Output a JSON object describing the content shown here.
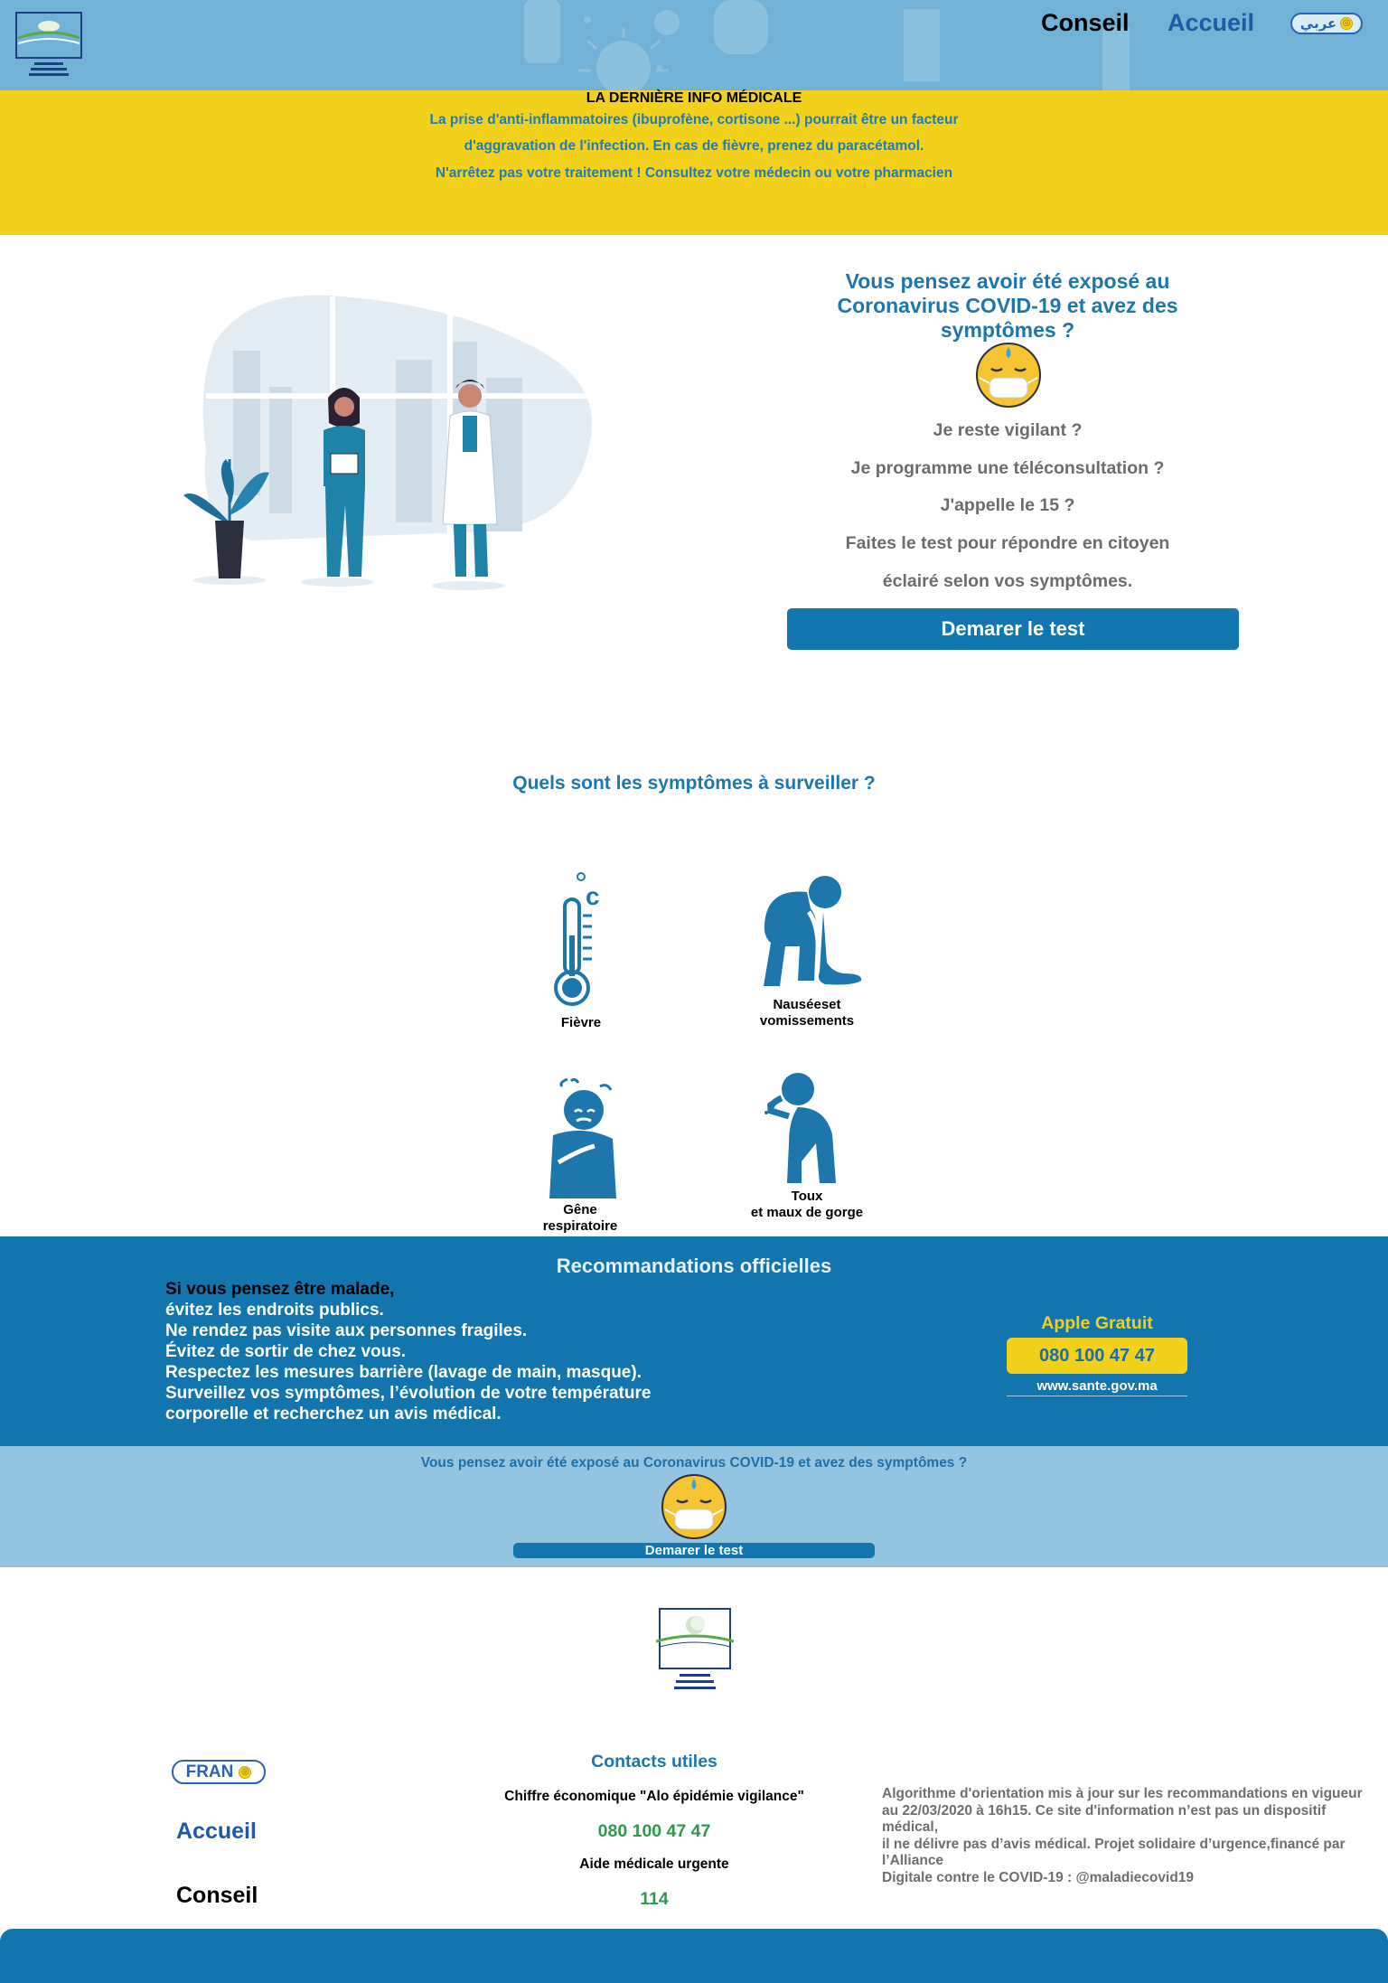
{
  "header": {
    "nav_conseil": "Conseil",
    "nav_accueil": "Accueil",
    "lang_label": "عربي"
  },
  "info": {
    "title": "LA DERNIÈRE INFO MÉDICALE",
    "line1": "La prise d'anti-inflammatoires (ibuprofène, cortisone ...) pourrait être un facteur",
    "line2": "d'aggravation de l'infection. En cas de fièvre, prenez du paracétamol.",
    "line3": "N'arrêtez pas votre traitement ! Consultez votre médecin ou votre pharmacien"
  },
  "hero": {
    "question": "Vous pensez avoir été exposé au Coronavirus COVID-19 et avez des symptômes ?",
    "lines": [
      "Je reste vigilant ?",
      "Je programme une téléconsultation ?",
      "J'appelle le 15 ?",
      "Faites le test pour répondre en citoyen",
      "éclairé selon vos symptômes."
    ],
    "button": "Demarer le test"
  },
  "symptoms": {
    "title": "Quels sont les symptômes à surveiller ?",
    "fever": "Fièvre",
    "nausea_1": "Nauséeset",
    "nausea_2": "vomissements",
    "breath_1": "Gêne",
    "breath_2": "respiratoire",
    "cough_1": "Toux",
    "cough_2": "et maux de gorge"
  },
  "reco": {
    "title": "Recommandations officielles",
    "lines": [
      "Si vous pensez être malade,",
      "évitez les endroits publics.",
      "Ne rendez pas visite aux personnes fragiles.",
      "Évitez de sortir de chez vous.",
      "Respectez les mesures barrière (lavage de main, masque).",
      "Surveillez vos symptômes, l’évolution de votre température",
      "corporelle et recherchez un avis médical."
    ],
    "apple_title": "Apple Gratuit",
    "apple_number": "080 100 47 47",
    "website": "www.sante.gov.ma"
  },
  "cta": {
    "question": "Vous pensez avoir été exposé au Coronavirus COVID-19 et avez des symptômes ?",
    "button": "Demarer le test"
  },
  "footer": {
    "lang_label": "FRAN",
    "accueil": "Accueil",
    "conseil": "Conseil",
    "contacts_title": "Contacts utiles",
    "contact1_label": "Chiffre économique \"Alo épidémie vigilance\"",
    "contact1_number": "080 100 47 47",
    "contact2_label": "Aide médicale urgente",
    "contact2_number": "114",
    "algo_lines": [
      "Algorithme d'orientation mis à jour sur les recommandations en vigueur",
      "au 22/03/2020 à 16h15. Ce site d'information n’est pas un dispositif",
      "médical,",
      "il ne délivre pas d’avis médical. Projet solidaire d’urgence,financé par",
      "l’Alliance",
      "Digitale contre le COVID-19 : @maladiecovid19"
    ]
  },
  "colors": {
    "header_bg": "#72b2d6",
    "banner_yellow": "#f2d11c",
    "primary_blue": "#1276b0",
    "cta_band": "#93c5e0",
    "accent_green": "#2f9a48"
  },
  "icons": [
    "ministry-logo",
    "globe-icon",
    "masked-face-emoji",
    "thermometer-icon",
    "vomiting-person-icon",
    "breathless-person-icon",
    "coughing-person-icon"
  ]
}
